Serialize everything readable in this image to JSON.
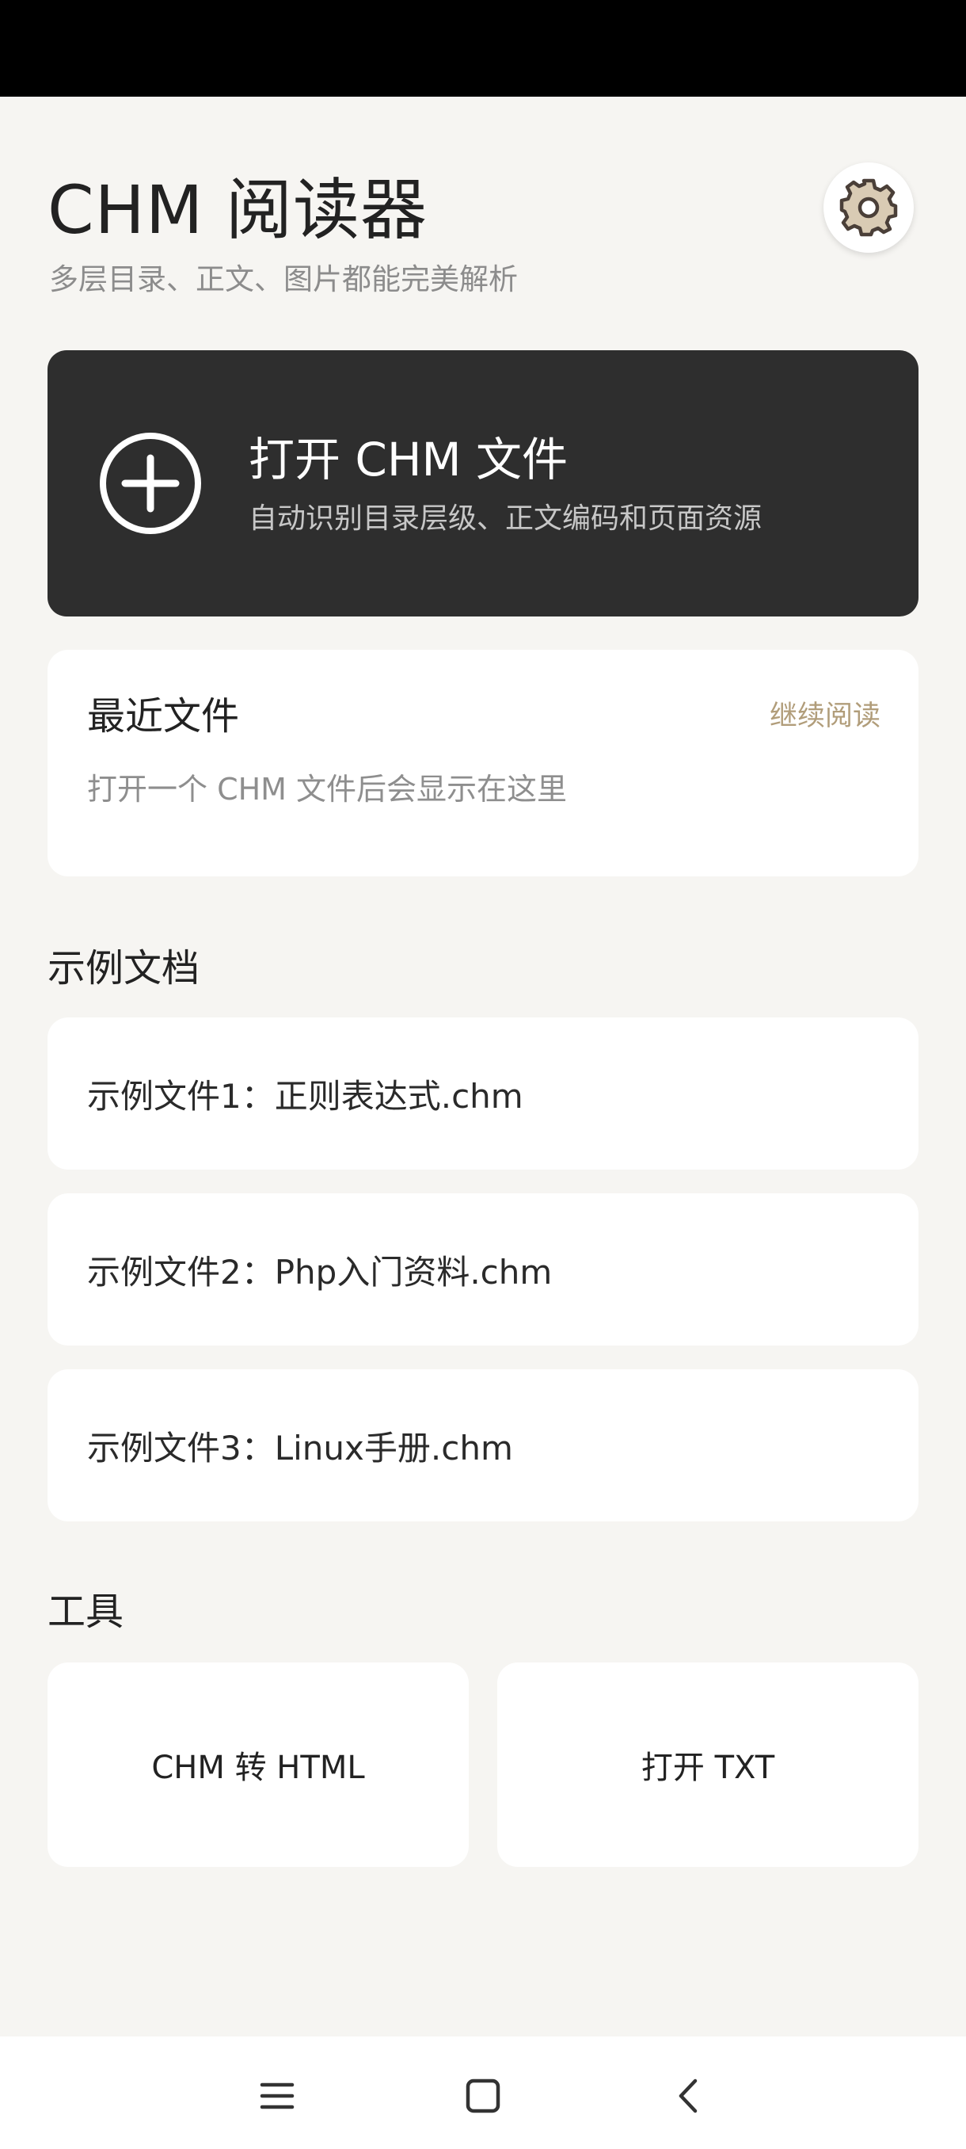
{
  "header": {
    "title": "CHM 阅读器",
    "subtitle": "多层目录、正文、图片都能完美解析",
    "settings_icon": "gear-icon"
  },
  "open_card": {
    "title": "打开 CHM 文件",
    "subtitle": "自动识别目录层级、正文编码和页面资源",
    "icon": "plus-circle-icon"
  },
  "recent": {
    "title": "最近文件",
    "continue_label": "继续阅读",
    "empty_text": "打开一个 CHM 文件后会显示在这里"
  },
  "samples": {
    "title": "示例文档",
    "items": [
      {
        "label": "示例文件1：正则表达式.chm"
      },
      {
        "label": "示例文件2：Php入门资料.chm"
      },
      {
        "label": "示例文件3：Linux手册.chm"
      }
    ]
  },
  "tools": {
    "title": "工具",
    "items": [
      {
        "label": "CHM 转 HTML"
      },
      {
        "label": "打开 TXT"
      }
    ]
  },
  "nav": {
    "menu_icon": "menu-icon",
    "home_icon": "home-icon",
    "back_icon": "back-icon"
  },
  "colors": {
    "background": "#f6f5f2",
    "open_card": "#2e2e2e",
    "accent_link": "#b19d7a"
  }
}
